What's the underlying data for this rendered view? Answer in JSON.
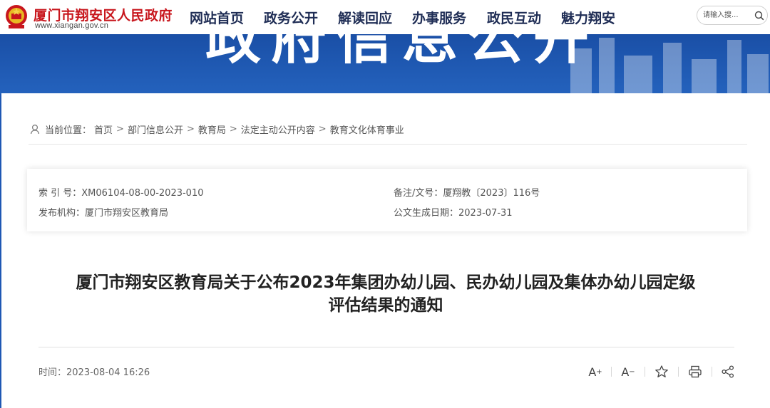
{
  "header": {
    "site_title": "厦门市翔安区人民政府",
    "site_url": "www.xiangan.gov.cn",
    "nav": [
      {
        "label": "网站首页"
      },
      {
        "label": "政务公开"
      },
      {
        "label": "解读回应"
      },
      {
        "label": "办事服务"
      },
      {
        "label": "政民互动"
      },
      {
        "label": "魅力翔安"
      }
    ],
    "search": {
      "placeholder": "请输入搜..."
    }
  },
  "banner": {
    "text": "政府信息公开"
  },
  "breadcrumb": {
    "prefix": "当前位置：",
    "items": [
      "首页",
      "部门信息公开",
      "教育局",
      "法定主动公开内容",
      "教育文化体育事业"
    ],
    "separator": ">"
  },
  "meta": {
    "index_no": "索 引 号：XM06104-08-00-2023-010",
    "doc_no": "备注/文号：厦翔教〔2023〕116号",
    "publisher": "发布机构：厦门市翔安区教育局",
    "created_date": "公文生成日期：2023-07-31"
  },
  "document": {
    "title_line1": "厦门市翔安区教育局关于公布2023年集团办幼儿园、民办幼儿园及集体办幼儿园定级",
    "title_line2": "评估结果的通知",
    "publish_time": "时间：2023-08-04 16:26"
  },
  "tools": {
    "font_increase": "A",
    "font_increase_sup": "+",
    "font_decrease": "A",
    "font_decrease_sup": "−",
    "icons": [
      "font-increase-icon",
      "font-decrease-icon",
      "star-icon",
      "print-icon",
      "share-icon"
    ]
  },
  "colors": {
    "brand_red": "#c8161d",
    "banner_blue": "#1f58b4",
    "nav_text": "#1f2d55"
  }
}
